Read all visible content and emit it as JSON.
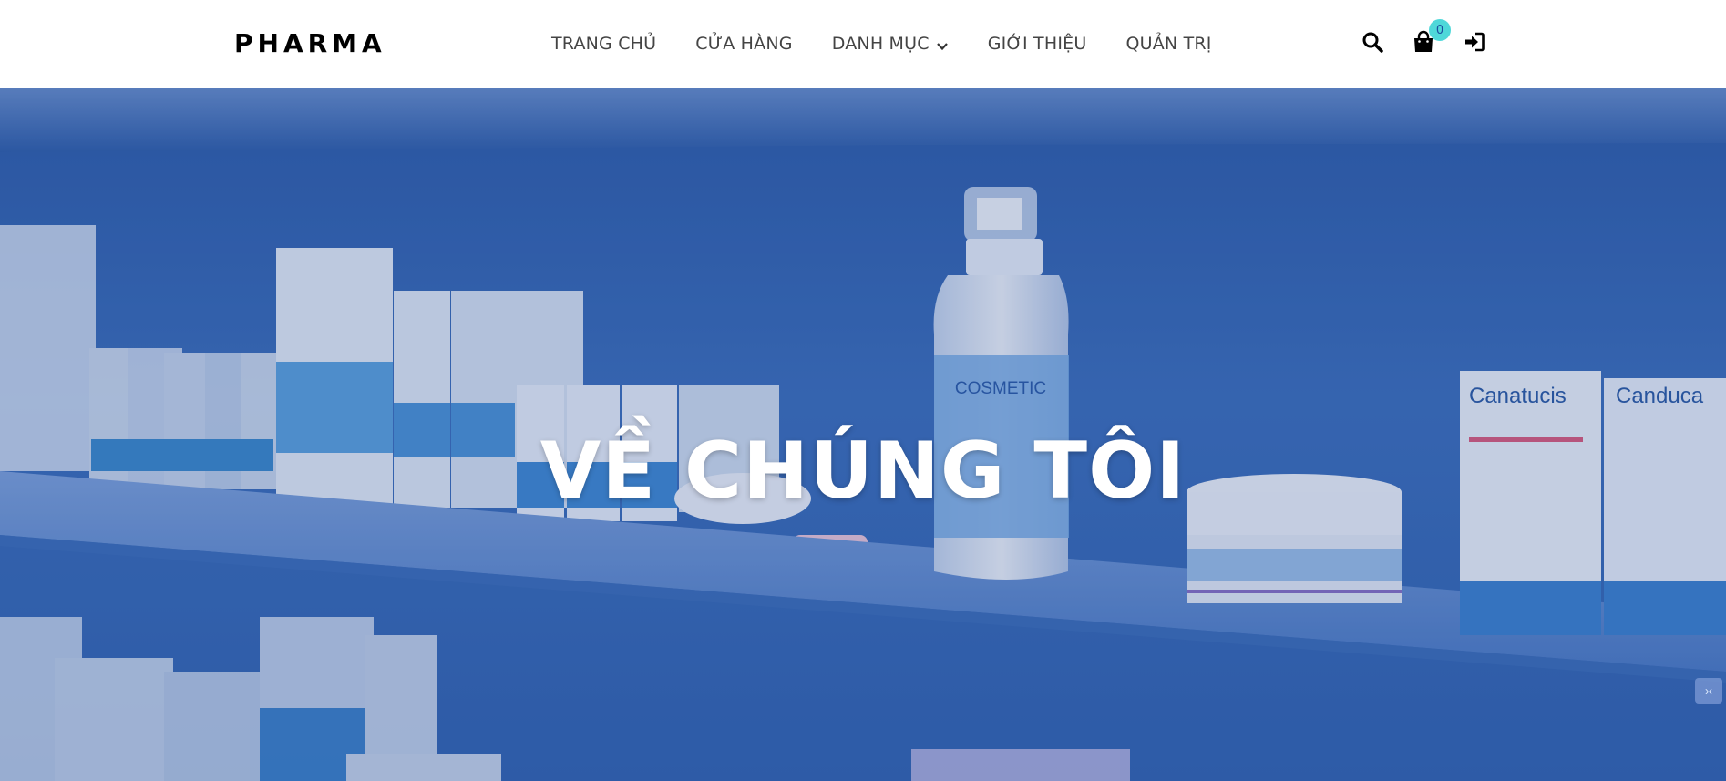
{
  "header": {
    "logo": "PHARMA",
    "nav": [
      {
        "label": "TRANG CHỦ"
      },
      {
        "label": "CỬA HÀNG"
      },
      {
        "label": "DANH MỤC"
      },
      {
        "label": "GIỚI THIỆU"
      },
      {
        "label": "QUẢN TRỊ"
      }
    ],
    "cart_count": "0",
    "icons": [
      "search-icon",
      "shopping-bag-icon",
      "sign-in-icon",
      "chevron-down-icon"
    ]
  },
  "hero": {
    "title": "VỀ CHÚNG TÔI",
    "product_labels": {
      "bottle": "COSMETIC",
      "box_a": "Canatucis",
      "box_b": "Canduca"
    }
  },
  "colors": {
    "brand": "#000000",
    "nav_text": "#444444",
    "badge": "#4fd8d9",
    "hero_blue": "#3c6fbc"
  }
}
